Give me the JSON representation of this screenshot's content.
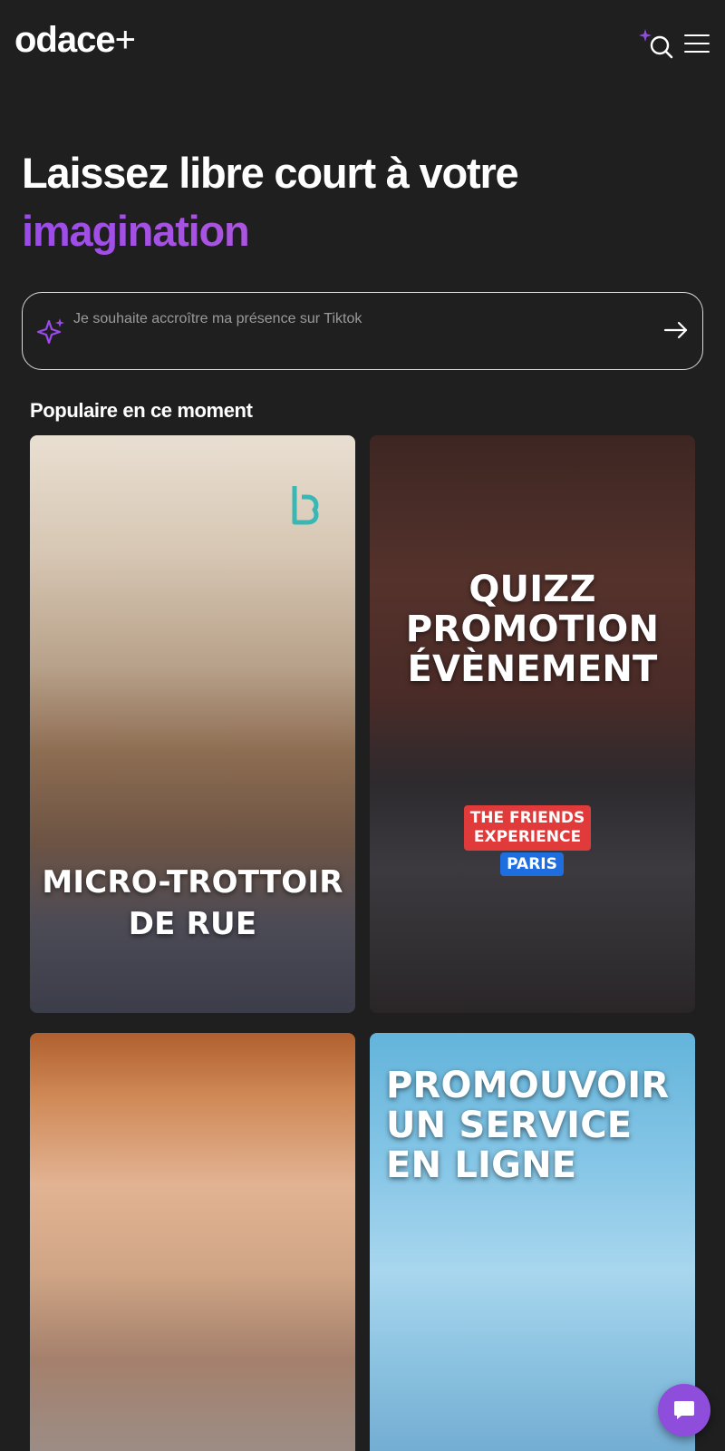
{
  "header": {
    "logo": "odace",
    "logo_plus": "+"
  },
  "hero": {
    "line1": "Laissez libre court à votre",
    "line2": "imagination"
  },
  "prompt": {
    "placeholder": "Je souhaite accroître ma présence sur Tiktok"
  },
  "section": {
    "title": "Populaire en ce moment"
  },
  "cards": [
    {
      "label_line1": "MICRO-TROTTOIR",
      "label_line2": "DE RUE"
    },
    {
      "label_line1": "QUIZZ",
      "label_line2": "PROMOTION",
      "label_line3": "ÉVÈNEMENT",
      "badge_red": "THE FRIENDS EXPERIENCE",
      "badge_blue": "PARIS"
    },
    {},
    {
      "label_line1": "PROMOUVOIR",
      "label_line2": "UN SERVICE",
      "label_line3": "EN LIGNE"
    }
  ],
  "colors": {
    "background": "#1f1f20",
    "accent_purple": "#9b4bea",
    "chat_button": "#8e4ddb"
  },
  "icons": {
    "search": "sparkle-search-icon",
    "menu": "hamburger-menu-icon",
    "prompt": "sparkle-icon",
    "submit": "arrow-right-icon",
    "chat": "chat-bubble-icon"
  }
}
